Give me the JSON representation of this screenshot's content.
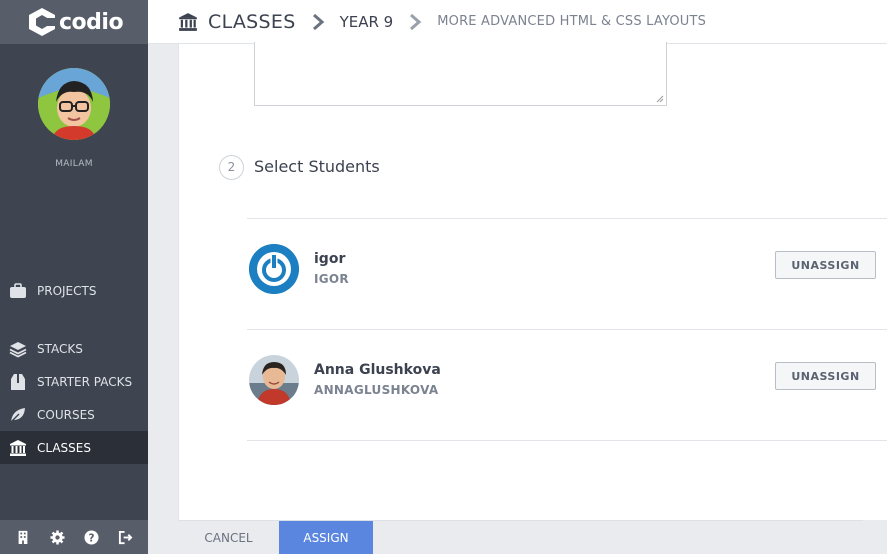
{
  "app": {
    "logo_text": "codio"
  },
  "sidebar": {
    "username": "MAILAM",
    "items": [
      {
        "label": "PROJECTS",
        "icon": "briefcase-icon"
      },
      {
        "label": "STACKS",
        "icon": "stack-icon"
      },
      {
        "label": "STARTER PACKS",
        "icon": "box-icon"
      },
      {
        "label": "COURSES",
        "icon": "leaf-icon"
      },
      {
        "label": "CLASSES",
        "icon": "institution-icon",
        "active": true
      }
    ],
    "bottom_icons": [
      "building-icon",
      "gear-icon",
      "help-icon",
      "logout-icon"
    ]
  },
  "breadcrumb": {
    "root": "CLASSES",
    "level2": "YEAR 9",
    "level3": "MORE ADVANCED HTML & CSS LAYOUTS"
  },
  "main": {
    "step_number": "2",
    "step_title": "Select Students",
    "students": [
      {
        "name": "igor",
        "handle": "IGOR",
        "action": "UNASSIGN"
      },
      {
        "name": "Anna Glushkova",
        "handle": "ANNAGLUSHKOVA",
        "action": "UNASSIGN"
      }
    ]
  },
  "footer": {
    "cancel_label": "CANCEL",
    "assign_label": "ASSIGN"
  },
  "colors": {
    "sidebar": "#3f4550",
    "accent": "#5a86e0",
    "active_nav": "#2a2f38"
  }
}
